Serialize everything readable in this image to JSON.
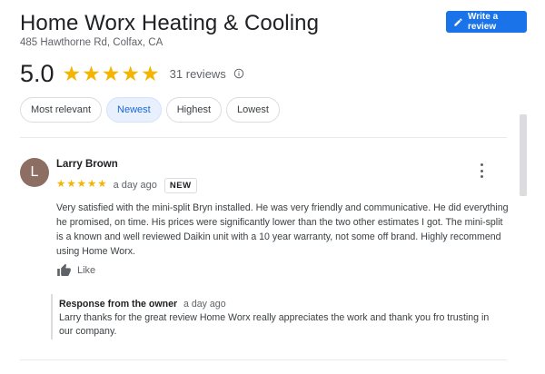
{
  "business": {
    "name": "Home Worx Heating & Cooling",
    "address": "485 Hawthorne Rd, Colfax, CA"
  },
  "actions": {
    "write_review_label": "Write a review"
  },
  "rating": {
    "average": "5.0",
    "stars": 5,
    "review_count_label": "31 reviews"
  },
  "sort_chips": [
    {
      "label": "Most relevant",
      "selected": false
    },
    {
      "label": "Newest",
      "selected": true
    },
    {
      "label": "Highest",
      "selected": false
    },
    {
      "label": "Lowest",
      "selected": false
    }
  ],
  "review": {
    "avatar_initial": "L",
    "reviewer_name": "Larry Brown",
    "stars": 5,
    "time": "a day ago",
    "badge": "NEW",
    "text": "Very satisfied with the mini-split Bryn installed.  He was very friendly and communicative. He did everything he promised, on time. His prices were significantly lower than the two other estimates I got. The mini-split is a known and well reviewed Daikin unit with a 10 year warranty, not some off brand. Highly recommend using Home Worx.",
    "like_label": "Like",
    "owner_response": {
      "title": "Response from the owner",
      "time": "a day ago",
      "text": "Larry thanks for the great review Home Worx really appreciates the work and thank you fro trusting in our company."
    }
  },
  "colors": {
    "accent": "#1a73e8",
    "star": "#f4b400",
    "avatar_bg": "#8d6e63",
    "chip_selected_bg": "#e8f0fe"
  },
  "icons": {
    "write_review": "pencil-icon",
    "info": "info-icon",
    "more": "more-vert-icon",
    "like": "thumb-up-icon"
  }
}
